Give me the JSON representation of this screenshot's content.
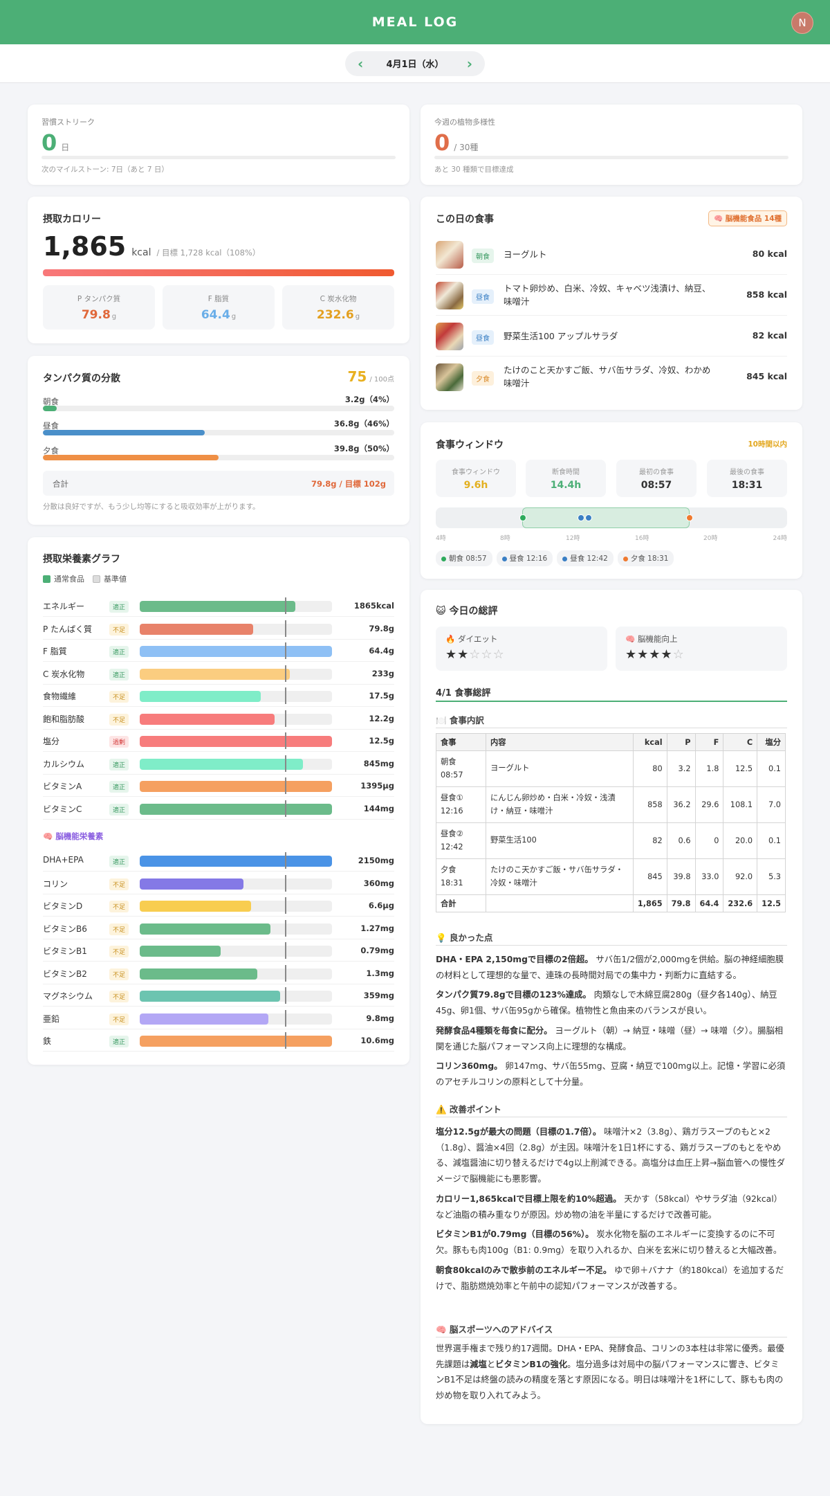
{
  "header": {
    "title": "MEAL LOG",
    "avatar": "N"
  },
  "date": {
    "label": "4月1日（水）",
    "prev": "‹",
    "next": "›"
  },
  "streak": {
    "label": "習慣ストリーク",
    "value": "0",
    "unit": "日",
    "progress": 0,
    "note": "次のマイルストーン: 7日（あと 7 日）"
  },
  "diversity": {
    "label": "今週の植物多様性",
    "value": "0",
    "unit": "/ 30種",
    "progress": 0,
    "note": "あと 30 種類で目標達成"
  },
  "calories": {
    "title": "摂取カロリー",
    "value": "1,865",
    "unit": "kcal",
    "target": "/ 目標 1,728 kcal（108%）",
    "progress": 1.0,
    "macros": [
      {
        "label": "P タンパク質",
        "value": "79.8",
        "unit": "g",
        "color": "#e0683a"
      },
      {
        "label": "F 脂質",
        "value": "64.4",
        "unit": "g",
        "color": "#6aaee8"
      },
      {
        "label": "C 炭水化物",
        "value": "232.6",
        "unit": "g",
        "color": "#e3a020"
      }
    ]
  },
  "protein": {
    "title": "タンパク質の分散",
    "score": "75",
    "score_unit": "/ 100点",
    "rows": [
      {
        "name": "朝食",
        "amount": "3.2g（4%）",
        "progress": 0.04,
        "color": "#4caf76"
      },
      {
        "name": "昼食",
        "amount": "36.8g（46%）",
        "progress": 0.46,
        "color": "#4a8fc9"
      },
      {
        "name": "夕食",
        "amount": "39.8g（50%）",
        "progress": 0.5,
        "color": "#ef8f45"
      }
    ],
    "total_label": "合計",
    "total_value": "79.8g / 目標 102g",
    "note": "分散は良好ですが、もう少し均等にすると吸収効率が上がります。"
  },
  "nutrients": {
    "title": "摂取栄養素グラフ",
    "legend": [
      "通常食品",
      "基準値"
    ],
    "brain_title": "🧠 脳機能栄養素",
    "rows": [
      {
        "name": "エネルギー",
        "status": "適正",
        "level": "ok",
        "fill": 0.81,
        "color": "#6bbb8a",
        "value": "1865kcal"
      },
      {
        "name": "P たんぱく質",
        "status": "不足",
        "level": "low",
        "fill": 0.59,
        "color": "#e8826a",
        "value": "79.8g"
      },
      {
        "name": "F 脂質",
        "status": "適正",
        "level": "ok",
        "fill": 1.0,
        "color": "#8ec0f5",
        "value": "64.4g"
      },
      {
        "name": "C 炭水化物",
        "status": "適正",
        "level": "ok",
        "fill": 0.78,
        "color": "#fbcd80",
        "value": "233g"
      },
      {
        "name": "食物繊維",
        "status": "不足",
        "level": "low",
        "fill": 0.63,
        "color": "#7fedc8",
        "value": "17.5g"
      },
      {
        "name": "飽和脂肪酸",
        "status": "不足",
        "level": "low",
        "fill": 0.7,
        "color": "#f77c7c",
        "value": "12.2g"
      },
      {
        "name": "塩分",
        "status": "過剰",
        "level": "over",
        "fill": 1.0,
        "color": "#f77c7c",
        "value": "12.5g"
      },
      {
        "name": "カルシウム",
        "status": "適正",
        "level": "ok",
        "fill": 0.85,
        "color": "#7fedc8",
        "value": "845mg"
      },
      {
        "name": "ビタミンA",
        "status": "適正",
        "level": "ok",
        "fill": 1.0,
        "color": "#f5a060",
        "value": "1395μg"
      },
      {
        "name": "ビタミンC",
        "status": "適正",
        "level": "ok",
        "fill": 1.0,
        "color": "#6bbb8a",
        "value": "144mg"
      }
    ],
    "brain_rows": [
      {
        "name": "DHA+EPA",
        "status": "適正",
        "level": "ok",
        "fill": 1.0,
        "color": "#4a93e6",
        "value": "2150mg"
      },
      {
        "name": "コリン",
        "status": "不足",
        "level": "low",
        "fill": 0.54,
        "color": "#8479e6",
        "value": "360mg"
      },
      {
        "name": "ビタミンD",
        "status": "不足",
        "level": "low",
        "fill": 0.58,
        "color": "#f8cd50",
        "value": "6.6μg"
      },
      {
        "name": "ビタミンB6",
        "status": "不足",
        "level": "low",
        "fill": 0.68,
        "color": "#6bbb8a",
        "value": "1.27mg"
      },
      {
        "name": "ビタミンB1",
        "status": "不足",
        "level": "low",
        "fill": 0.42,
        "color": "#6bbb8a",
        "value": "0.79mg"
      },
      {
        "name": "ビタミンB2",
        "status": "不足",
        "level": "low",
        "fill": 0.61,
        "color": "#6bbb8a",
        "value": "1.3mg"
      },
      {
        "name": "マグネシウム",
        "status": "不足",
        "level": "low",
        "fill": 0.73,
        "color": "#6cc4b0",
        "value": "359mg"
      },
      {
        "name": "亜鉛",
        "status": "不足",
        "level": "low",
        "fill": 0.67,
        "color": "#b3a7f5",
        "value": "9.8mg"
      },
      {
        "name": "鉄",
        "status": "適正",
        "level": "ok",
        "fill": 1.0,
        "color": "#f5a060",
        "value": "10.6mg"
      }
    ]
  },
  "meals": {
    "title": "この日の食事",
    "badge": "🧠 脳機能食品 14種",
    "items": [
      {
        "type": "朝食",
        "name": "ヨーグルト",
        "kcal": "80 kcal"
      },
      {
        "type": "昼食",
        "name": "トマト卵炒め、白米、冷奴、キャベツ浅漬け、納豆、味噌汁",
        "kcal": "858 kcal"
      },
      {
        "type": "昼食",
        "name": "野菜生活100 アップルサラダ",
        "kcal": "82 kcal"
      },
      {
        "type": "夕食",
        "name": "たけのこと天かすご飯、サバ缶サラダ、冷奴、わかめ味噌汁",
        "kcal": "845 kcal"
      }
    ]
  },
  "window": {
    "title": "食事ウィンドウ",
    "badge": "10時間以内",
    "stats": [
      {
        "label": "食事ウィンドウ",
        "value": "9.6h",
        "color": "#e3b020"
      },
      {
        "label": "断食時間",
        "value": "14.4h",
        "color": "#4caf76"
      },
      {
        "label": "最初の食事",
        "value": "08:57",
        "color": "#333333"
      },
      {
        "label": "最後の食事",
        "value": "18:31",
        "color": "#333333"
      }
    ],
    "ticks": [
      "4時",
      "8時",
      "12時",
      "16時",
      "20時",
      "24時"
    ],
    "chips": [
      {
        "label": "朝食 08:57",
        "color": "#2eaa5c"
      },
      {
        "label": "昼食 12:16",
        "color": "#3a7fc4"
      },
      {
        "label": "昼食 12:42",
        "color": "#3a7fc4"
      },
      {
        "label": "夕食 18:31",
        "color": "#ef7a30"
      }
    ]
  },
  "review": {
    "title": "😺 今日の総評",
    "ratings": [
      {
        "label": "🔥 ダイエット",
        "stars": 2
      },
      {
        "label": "🧠 脳機能向上",
        "stars": 4
      }
    ],
    "heading": "4/1 食事総評",
    "table_title": "🍽️ 食事内訳",
    "table_header": [
      "食事",
      "内容",
      "kcal",
      "P",
      "F",
      "C",
      "塩分"
    ],
    "table_rows": [
      [
        "朝食\n08:57",
        "ヨーグルト",
        "80",
        "3.2",
        "1.8",
        "12.5",
        "0.1"
      ],
      [
        "昼食①\n12:16",
        "にんじん卵炒め・白米・冷奴・浅漬け・納豆・味噌汁",
        "858",
        "36.2",
        "29.6",
        "108.1",
        "7.0"
      ],
      [
        "昼食②\n12:42",
        "野菜生活100",
        "82",
        "0.6",
        "0",
        "20.0",
        "0.1"
      ],
      [
        "夕食\n18:31",
        "たけのこ天かすご飯・サバ缶サラダ・冷奴・味噌汁",
        "845",
        "39.8",
        "33.0",
        "92.0",
        "5.3"
      ]
    ],
    "table_total": [
      "合計",
      "",
      "1,865",
      "79.8",
      "64.4",
      "232.6",
      "12.5"
    ],
    "good_title": "💡 良かった点",
    "good": [
      {
        "b": "DHA・EPA 2,150mgで目標の2倍超。",
        "t": "サバ缶1/2個が2,000mgを供給。脳の神経細胞膜の材料として理想的な量で、連珠の長時間対局での集中力・判断力に直結する。"
      },
      {
        "b": "タンパク質79.8gで目標の123%達成。",
        "t": "肉類なしで木綿豆腐280g（昼夕各140g）、納豆45g、卵1個、サバ缶95gから確保。植物性と魚由来のバランスが良い。"
      },
      {
        "b": "発酵食品4種類を毎食に配分。",
        "t": "ヨーグルト（朝）→ 納豆・味噌（昼）→ 味噌（夕）。腸脳相関を通じた脳パフォーマンス向上に理想的な構成。"
      },
      {
        "b": "コリン360mg。",
        "t": "卵147mg、サバ缶55mg、豆腐・納豆で100mg以上。記憶・学習に必須のアセチルコリンの原料として十分量。"
      }
    ],
    "improve_title": "⚠️ 改善ポイント",
    "improve": [
      {
        "b": "塩分12.5gが最大の問題（目標の1.7倍）。",
        "t": "味噌汁×2（3.8g）、鶏ガラスープのもと×2（1.8g）、醤油×4回（2.8g）が主因。味噌汁を1日1杯にする、鶏ガラスープのもとをやめる、減塩醤油に切り替えるだけで4g以上削減できる。高塩分は血圧上昇→脳血管への慢性ダメージで脳機能にも悪影響。"
      },
      {
        "b": "カロリー1,865kcalで目標上限を約10%超過。",
        "t": "天かす（58kcal）やサラダ油（92kcal）など油脂の積み重なりが原因。炒め物の油を半量にするだけで改善可能。"
      },
      {
        "b": "ビタミンB1が0.79mg（目標の56%）。",
        "t": "炭水化物を脳のエネルギーに変換するのに不可欠。豚もも肉100g（B1: 0.9mg）を取り入れるか、白米を玄米に切り替えると大幅改善。"
      },
      {
        "b": "朝食80kcalのみで散歩前のエネルギー不足。",
        "t": "ゆで卵＋バナナ（約180kcal）を追加するだけで、脂肪燃焼効率と午前中の認知パフォーマンスが改善する。"
      }
    ],
    "advice_title": "🧠 脳スポーツへのアドバイス",
    "advice_1": "世界選手権まで残り約17週間。DHA・EPA、発酵食品、コリンの3本柱は非常に優秀。最優先課題は",
    "advice_b1": "減塩",
    "advice_2": "と",
    "advice_b2": "ビタミンB1の強化",
    "advice_3": "。塩分過多は対局中の脳パフォーマンスに響き、ビタミンB1不足は終盤の読みの精度を落とす原因になる。明日は味噌汁を1杯にして、豚もも肉の炒め物を取り入れてみよう。"
  }
}
